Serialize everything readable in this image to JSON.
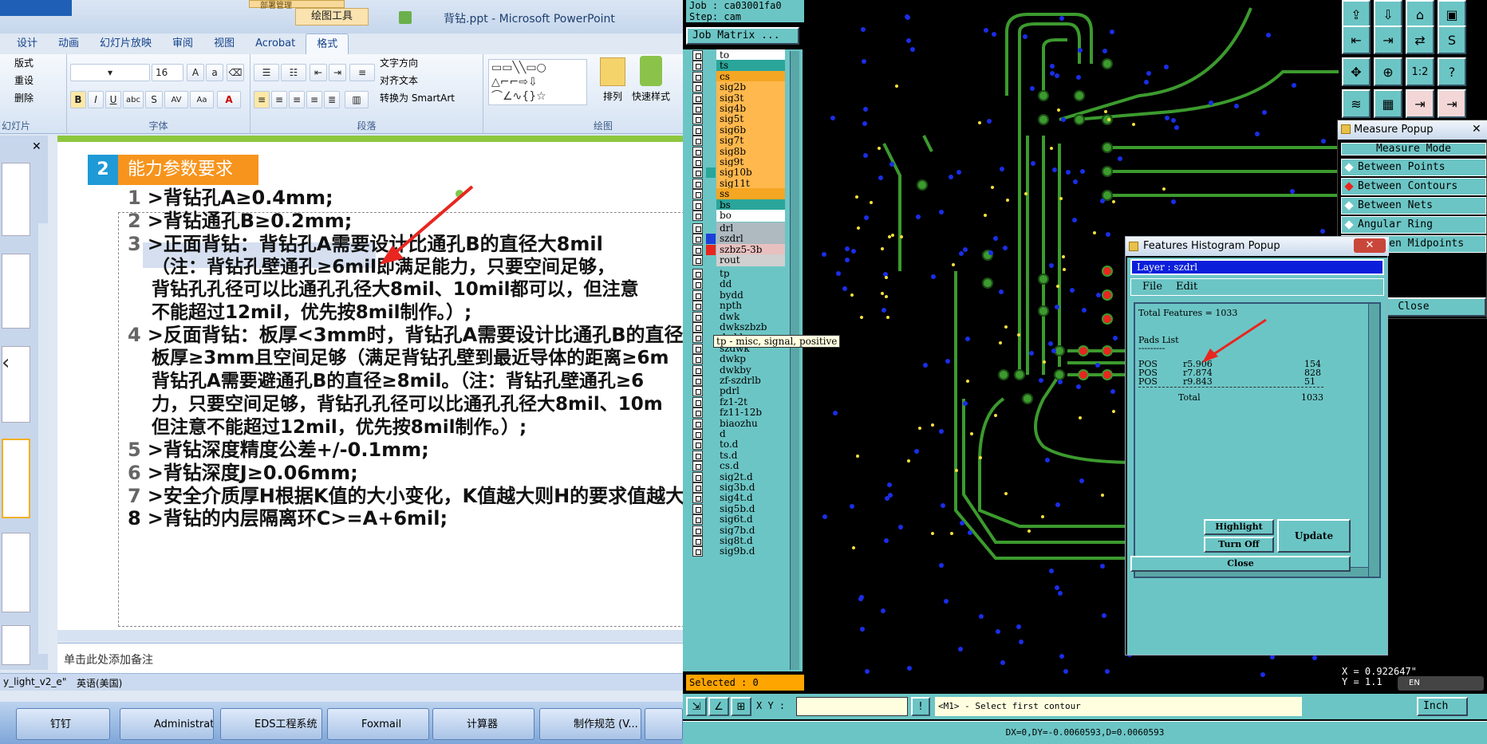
{
  "ppt": {
    "title": "背钻.ppt - Microsoft PowerPoint",
    "tools_tab": "绘图工具",
    "tools_tab2": "部署管理",
    "tabs": [
      "设计",
      "动画",
      "幻灯片放映",
      "审阅",
      "视图",
      "Acrobat",
      "格式"
    ],
    "groups": {
      "slides": "幻灯片",
      "font": "字体",
      "paragraph": "段落",
      "drawing": "绘图"
    },
    "slides_buttons": [
      "版式",
      "重设",
      "删除"
    ],
    "font_size": "16",
    "text_direction": "文字方向",
    "align_text": "对齐文本",
    "smartart": "转换为 SmartArt",
    "arrange": "排列",
    "quick_styles": "快速样式",
    "slide": {
      "badge_num": "2",
      "heading": "能力参数要求",
      "lines": [
        {
          "n": "1",
          "t": ">背钻孔A≥0.4mm;"
        },
        {
          "n": "2",
          "t": ">背钻通孔B≥0.2mm;"
        },
        {
          "n": "3",
          "t": ">正面背钻：背钻孔A需要设计比通孔B的直径大8mil"
        },
        {
          "n": "",
          "t": "（注：背钻孔壁通孔≥6mil即满足能力，只要空间足够，"
        },
        {
          "n": "",
          "t": "背钻孔孔径可以比通孔孔径大8mil、10mil都可以，但注意"
        },
        {
          "n": "",
          "t": "不能超过12mil，优先按8mil制作。）;"
        },
        {
          "n": "4",
          "t": ">反面背钻：板厚<3mm时，背钻孔A需要设计比通孔B的直径"
        },
        {
          "n": "",
          "t": "板厚≥3mm且空间足够（满足背钻孔壁到最近导体的距离≥6m"
        },
        {
          "n": "",
          "t": "背钻孔A需要避通孔B的直径≥8mil。（注：背钻孔壁通孔≥6"
        },
        {
          "n": "",
          "t": "力，只要空间足够，背钻孔孔径可以比通孔孔径大8mil、10m"
        },
        {
          "n": "",
          "t": "但注意不能超过12mil，优先按8mil制作。）;"
        },
        {
          "n": "5",
          "t": ">背钻深度精度公差+/-0.1mm;"
        },
        {
          "n": "6",
          "t": ">背钻深度J≥0.06mm;"
        },
        {
          "n": "7",
          "t": ">安全介质厚H根据K值的大小变化，K值越大则H的要求值越大"
        },
        {
          "n": "8",
          "t": ">背钻的内层隔离环C>=A+6mil;"
        }
      ]
    },
    "notes_placeholder": "单击此处添加备注",
    "status_theme": "y_light_v2_e\"",
    "status_lang": "英语(美国)"
  },
  "taskbar": [
    "钉钉",
    "Administrat...",
    "EDS工程系统",
    "Foxmail",
    "计算器",
    "制作规范 (V..."
  ],
  "cam": {
    "job": "Job : ca03001fa0",
    "step": "Step: cam",
    "job_matrix": "Job Matrix ...",
    "layers_a": [
      "to",
      "ts",
      "cs",
      "sig2b",
      "sig3t",
      "sig4b",
      "sig5t",
      "sig6b",
      "sig7t",
      "sig8b",
      "sig9t",
      "sig10b",
      "sig11t",
      "ss",
      "bs",
      "bo"
    ],
    "layers_b": [
      "drl",
      "szdrl",
      "szbz5-3b",
      "rout"
    ],
    "layers_c": [
      "tp",
      "dd",
      "bydd",
      "npth",
      "dwk",
      "dwkszbzb",
      "dwkb",
      "szdwk",
      "dwkp",
      "dwkby",
      "zf-szdrlb",
      "pdrl",
      "fz1-2t",
      "fz11-12b",
      "biaozhu",
      "d",
      "to.d",
      "ts.d",
      "cs.d",
      "sig2t.d",
      "sig3b.d",
      "sig4t.d",
      "sig5b.d",
      "sig6t.d",
      "sig7b.d",
      "sig8t.d",
      "sig9b.d"
    ],
    "tooltip": "tp - misc, signal, positive",
    "selected": "Selected : 0",
    "xy_label": "X Y :",
    "prompt": "<M1> - Select first contour",
    "unit": "Inch",
    "status": "DX=0,DY=-0.0060593,D=0.0060593",
    "coords_x": "X = 0.922647\"",
    "coords_y": "Y = 1.1",
    "ime": "EN",
    "measure": {
      "title": "Measure Popup",
      "mode": "Measure Mode",
      "options": [
        "Between Points",
        "Between Contours",
        "Between Nets",
        "Angular Ring",
        "Between Midpoints"
      ],
      "close": "Close"
    },
    "hist": {
      "title": "Features Histogram Popup",
      "layer": "Layer :  szdrl",
      "menu": [
        "File",
        "Edit"
      ],
      "total": "Total Features = 1033",
      "pads_title": "Pads List",
      "dash": "---------",
      "rows": [
        {
          "type": "POS",
          "sym": "r5.906",
          "count": "154"
        },
        {
          "type": "POS",
          "sym": "r7.874",
          "count": "828"
        },
        {
          "type": "POS",
          "sym": "r9.843",
          "count": "51"
        }
      ],
      "total_label": "Total",
      "total_count": "1033",
      "highlight": "Highlight",
      "turn_off": "Turn Off",
      "update": "Update",
      "close": "Close"
    }
  }
}
